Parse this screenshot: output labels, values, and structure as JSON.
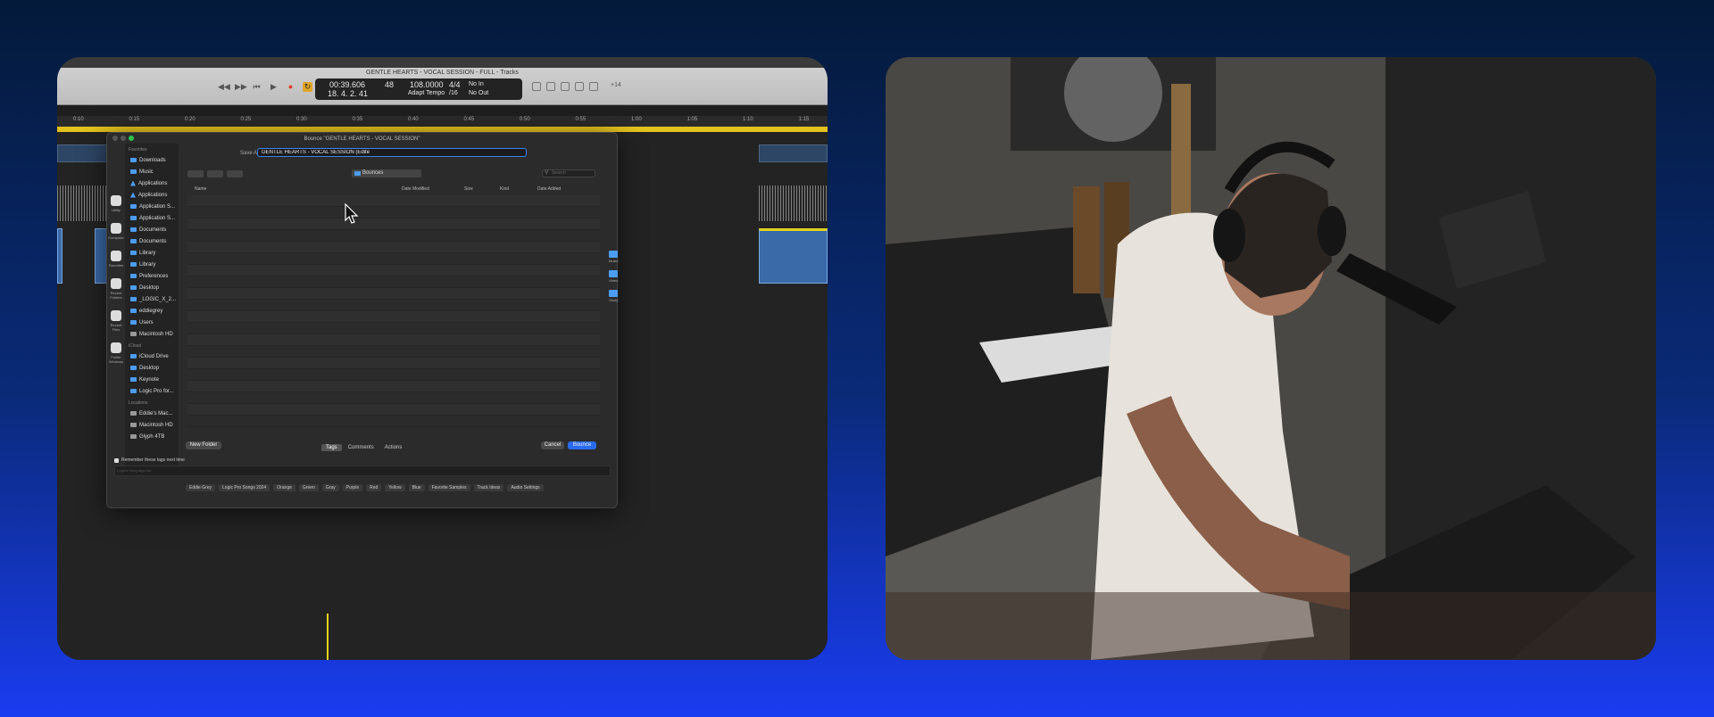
{
  "window": {
    "title": "GENTLE HEARTS - VOCAL SESSION - FULL - Tracks"
  },
  "lcd": {
    "time": "00:39.606",
    "position": "18. 4. 2.  41",
    "bpm_top": "48",
    "tempo": "108.0000",
    "tempo_mode": "Adapt Tempo",
    "signature": "4/4",
    "division": "/16",
    "in": "No In",
    "out": "No Out",
    "key": "+14"
  },
  "ruler": [
    "0:10",
    "0:15",
    "0:20",
    "0:25",
    "0:30",
    "0:35",
    "0:40",
    "0:45",
    "0:50",
    "0:55",
    "1:00",
    "1:05",
    "1:10",
    "1:15"
  ],
  "dialog": {
    "title": "Bounce \"GENTLE HEARTS - VOCAL SESSION\"",
    "save_as_label": "Save As:",
    "save_as_value": "GENTLE HEARTS - VOCAL SESSION (Edite",
    "location": "Bounces",
    "search_placeholder": "Search",
    "columns": {
      "name": "Name",
      "date_modified": "Date Modified",
      "size": "Size",
      "kind": "Kind",
      "date_added": "Date Added"
    },
    "sidebar": {
      "favorites_label": "Favorites",
      "favorites": [
        {
          "label": "Downloads",
          "icon": "folder-icon"
        },
        {
          "label": "Music",
          "icon": "folder-icon"
        },
        {
          "label": "Applications",
          "icon": "app-icon"
        },
        {
          "label": "Applications",
          "icon": "app-icon"
        },
        {
          "label": "Application S...",
          "icon": "folder-icon"
        },
        {
          "label": "Application S...",
          "icon": "folder-icon"
        },
        {
          "label": "Documents",
          "icon": "folder-icon"
        },
        {
          "label": "Documents",
          "icon": "folder-icon"
        },
        {
          "label": "Library",
          "icon": "folder-icon"
        },
        {
          "label": "Library",
          "icon": "folder-icon"
        },
        {
          "label": "Preferences",
          "icon": "folder-icon"
        },
        {
          "label": "Desktop",
          "icon": "folder-icon"
        },
        {
          "label": "_LOGIC_X_2...",
          "icon": "folder-icon"
        },
        {
          "label": "eddiegrey",
          "icon": "folder-icon"
        },
        {
          "label": "Users",
          "icon": "folder-icon"
        },
        {
          "label": "Macintosh HD",
          "icon": "disk-icon"
        }
      ],
      "icloud_label": "iCloud",
      "icloud": [
        {
          "label": "iCloud Drive",
          "icon": "folder-icon"
        },
        {
          "label": "Desktop",
          "icon": "folder-icon"
        },
        {
          "label": "Keynote",
          "icon": "folder-icon"
        },
        {
          "label": "Logic Pro for...",
          "icon": "folder-icon"
        }
      ],
      "locations_label": "Locations",
      "locations": [
        {
          "label": "Eddie's Mac...",
          "icon": "disk-icon"
        },
        {
          "label": "Macintosh HD",
          "icon": "disk-icon"
        },
        {
          "label": "Glyph 4TB",
          "icon": "disk-icon"
        }
      ],
      "left_icons": [
        "Utility",
        "Computer",
        "Favorites",
        "Recent Folders",
        "Recent Files",
        "Folder Windows"
      ]
    },
    "right_folders": [
      "Music",
      "Video",
      "Study"
    ],
    "buttons": {
      "new_folder": "New Folder",
      "cancel": "Cancel",
      "bounce": "Bounce"
    },
    "tabs": [
      "Tags",
      "Comments",
      "Actions"
    ],
    "remember_label": "Remember these tags next time",
    "tag_placeholder": "Logic's Song tags bar",
    "tags": [
      "Eddie Grey",
      "Logic Pro Songs 2024",
      "Orange",
      "Green",
      "Gray",
      "Purple",
      "Red",
      "Yellow",
      "Blue",
      "Favorite Samples",
      "Track Ideas",
      "Audio Settings"
    ]
  },
  "colors": {
    "accent": "#2a6bf0",
    "record": "#e23b2a",
    "cycle": "#e3c21d"
  }
}
